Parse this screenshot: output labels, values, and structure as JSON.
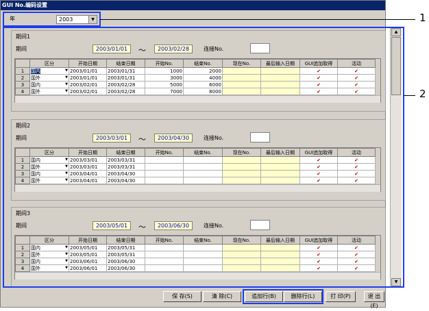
{
  "window": {
    "title": "GUI No.编码设置"
  },
  "year": {
    "label": "年",
    "value": "2003"
  },
  "columns": [
    "区分",
    "开始日期",
    "结束日期",
    "开始No.",
    "结束No.",
    "现在No.",
    "最后输入日期",
    "GUI追加取得",
    "活动"
  ],
  "periods": [
    {
      "title": "期间1",
      "label": "期间",
      "start": "2003/01/01",
      "end": "2003/02/28",
      "tilde": "～",
      "link_label": "连接No.",
      "rows": [
        {
          "n": "1",
          "div": "国内",
          "s": "2003/01/01",
          "e": "2003/01/31",
          "sn": "1000",
          "en": "2000"
        },
        {
          "n": "2",
          "div": "国外",
          "s": "2003/01/01",
          "e": "2003/01/31",
          "sn": "3000",
          "en": "4000"
        },
        {
          "n": "3",
          "div": "国内",
          "s": "2003/02/01",
          "e": "2003/02/28",
          "sn": "5000",
          "en": "6000"
        },
        {
          "n": "4",
          "div": "国外",
          "s": "2003/02/01",
          "e": "2003/02/28",
          "sn": "7000",
          "en": "8000"
        }
      ]
    },
    {
      "title": "期间2",
      "label": "期间",
      "start": "2003/03/01",
      "end": "2003/04/30",
      "tilde": "～",
      "link_label": "连接No.",
      "rows": [
        {
          "n": "1",
          "div": "国内",
          "s": "2003/03/01",
          "e": "2003/03/31",
          "sn": "",
          "en": ""
        },
        {
          "n": "2",
          "div": "国外",
          "s": "2003/03/01",
          "e": "2003/03/31",
          "sn": "",
          "en": ""
        },
        {
          "n": "3",
          "div": "国内",
          "s": "2003/04/01",
          "e": "2003/04/30",
          "sn": "",
          "en": ""
        },
        {
          "n": "4",
          "div": "国外",
          "s": "2003/04/01",
          "e": "2003/04/30",
          "sn": "",
          "en": ""
        }
      ]
    },
    {
      "title": "期间3",
      "label": "期间",
      "start": "2003/05/01",
      "end": "2003/06/30",
      "tilde": "～",
      "link_label": "连接No.",
      "rows": [
        {
          "n": "1",
          "div": "国内",
          "s": "2003/05/01",
          "e": "2003/05/31",
          "sn": "",
          "en": ""
        },
        {
          "n": "2",
          "div": "国外",
          "s": "2003/05/01",
          "e": "2003/05/31",
          "sn": "",
          "en": ""
        },
        {
          "n": "3",
          "div": "国内",
          "s": "2003/06/01",
          "e": "2003/06/30",
          "sn": "",
          "en": ""
        },
        {
          "n": "4",
          "div": "国外",
          "s": "2003/06/01",
          "e": "2003/06/30",
          "sn": "",
          "en": ""
        }
      ]
    }
  ],
  "buttons": {
    "save": "保 存(S)",
    "clear": "清 除(C)",
    "add_row": "追加行(B)",
    "del_row": "删除行(L)",
    "print": "打 印(P)",
    "exit": "退 出(E)"
  },
  "callouts": {
    "one": "1",
    "two": "2"
  },
  "colors": {
    "highlight": "#1d3cf0",
    "title_bar": "#0a246a",
    "date_fill": "#ffffc8"
  }
}
